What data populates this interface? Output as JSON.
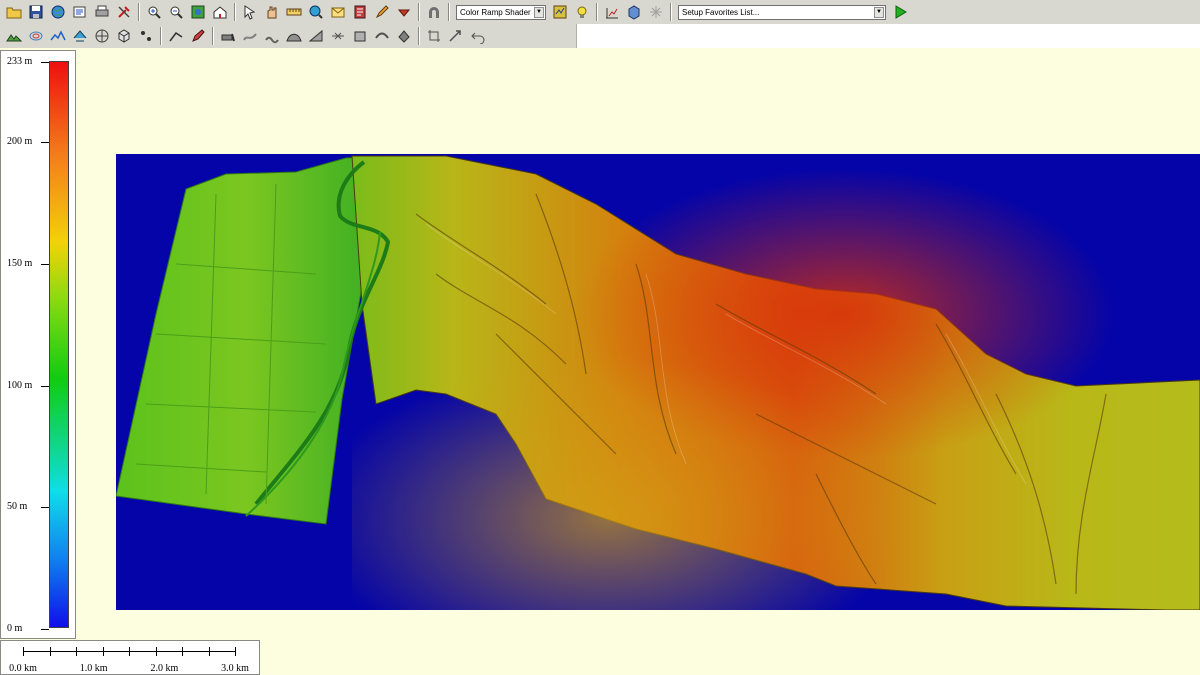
{
  "toolbar": {
    "row1_left_icons": [
      "open-folder-icon",
      "save-icon",
      "globe-icon",
      "layer-properties-icon",
      "print-icon",
      "tools-icon"
    ],
    "row1_nav_icons": [
      "zoom-in-icon",
      "zoom-out-icon",
      "full-extent-icon",
      "home-icon"
    ],
    "row1_mid_icons": [
      "select-icon",
      "pan-icon",
      "measure-icon",
      "globe-search-icon",
      "envelope-icon",
      "inspect-icon",
      "edit-icon",
      "bookmark-icon"
    ],
    "row1_extra_icon": "tunnel-icon",
    "shader_select": "Color Ramp Shader",
    "shader_icons": [
      "shader-settings-icon",
      "lighting-icon"
    ],
    "row1_right_icons": [
      "chart-icon",
      "3d-view-icon",
      "sparkle-icon"
    ],
    "favorites_select": "Setup Favorites List...",
    "run_icon": "play-icon",
    "row2_icons": [
      "terrain-icon",
      "contour-icon",
      "profile-icon",
      "watershed-icon",
      "grid-icon",
      "cube-icon",
      "point-tool-icon",
      "line-tool-icon",
      "pen-icon",
      "dozer-icon",
      "stream-icon",
      "flow-icon",
      "hill-icon",
      "slope-icon",
      "cut-fill-icon",
      "volume-icon",
      "smooth-icon",
      "fill-icon",
      "crop-icon",
      "transform-icon",
      "undo-icon"
    ]
  },
  "legend": {
    "labels": [
      "233 m",
      "200 m",
      "150 m",
      "100 m",
      "50 m",
      "0 m"
    ],
    "values": [
      233,
      200,
      150,
      100,
      50,
      0
    ],
    "max": 233,
    "min": 0,
    "colors": [
      "#ee1010",
      "#f47a1a",
      "#f2d20a",
      "#10cc10",
      "#10dde8",
      "#1010e8"
    ]
  },
  "scale_bar": {
    "labels": [
      "0.0 km",
      "1.0 km",
      "2.0 km",
      "3.0 km"
    ]
  },
  "map": {
    "background_color": "#0404a8"
  }
}
